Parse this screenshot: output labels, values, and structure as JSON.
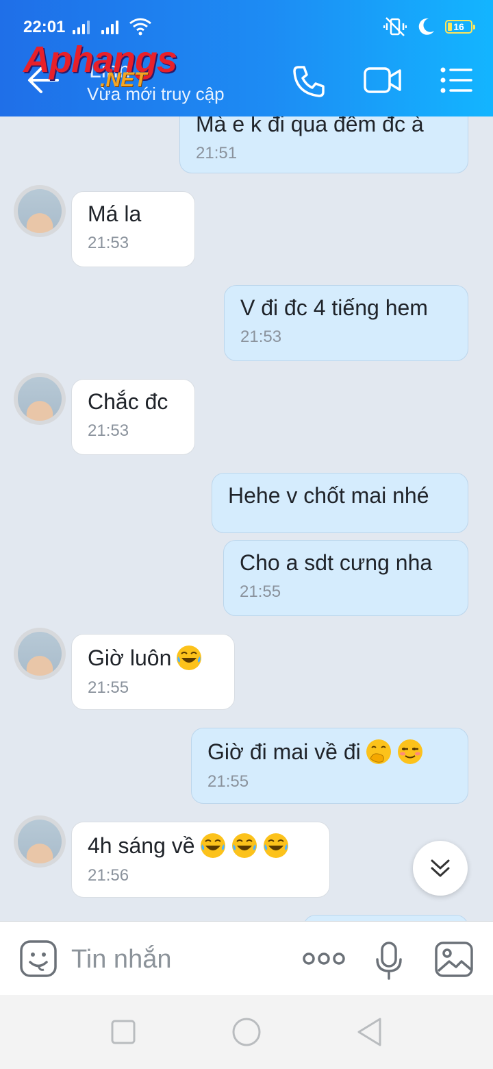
{
  "status_bar": {
    "time": "22:01",
    "battery": "16"
  },
  "header": {
    "contact_name": "Linh",
    "contact_status": "Vừa mới truy cập",
    "watermark_main": "Aphangs",
    "watermark_sub": ".NET"
  },
  "messages": [
    {
      "side": "out",
      "text": "Mà e k đi qua đêm đc à",
      "time": "21:51"
    },
    {
      "side": "in",
      "text": "Má la",
      "time": "21:53"
    },
    {
      "side": "out",
      "text": "V đi đc 4 tiếng hem",
      "time": "21:53"
    },
    {
      "side": "in",
      "text": "Chắc đc",
      "time": "21:53"
    },
    {
      "side": "out",
      "text": "Hehe v chốt mai nhé",
      "time": ""
    },
    {
      "side": "out",
      "text": "Cho a sdt cưng nha",
      "time": "21:55"
    },
    {
      "side": "in",
      "text": "Giờ luôn",
      "time": "21:55"
    },
    {
      "side": "out",
      "text": "Giờ đi mai về đi",
      "time": "21:55"
    },
    {
      "side": "in",
      "text": "4h sáng về",
      "time": "21:56"
    }
  ],
  "input": {
    "placeholder": "Tin nhắn"
  },
  "icons": [
    "back-arrow-icon",
    "phone-icon",
    "video-call-icon",
    "menu-icon",
    "emoji-sticker-icon",
    "more-options-icon",
    "microphone-icon",
    "image-gallery-icon",
    "scroll-down-icon",
    "nav-recent-icon",
    "nav-home-icon",
    "nav-back-icon"
  ],
  "colors": {
    "header_gradient_start": "#1f6fe8",
    "header_gradient_end": "#13b5ff",
    "outgoing_bubble": "#d5ecfd",
    "incoming_bubble": "#ffffff",
    "chat_background": "#e2e8f0"
  }
}
